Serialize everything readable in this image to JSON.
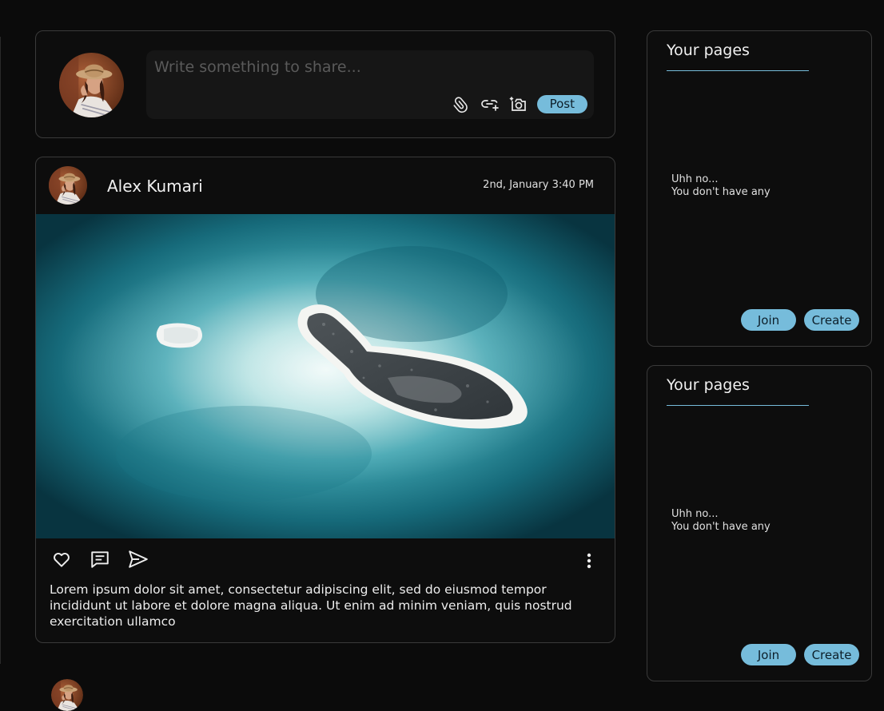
{
  "composer": {
    "placeholder": "Write something to share...",
    "post_label": "Post",
    "icons": [
      "paperclip-icon",
      "link-add-icon",
      "camera-icon"
    ]
  },
  "post": {
    "author": "Alex Kumari",
    "timestamp": "2nd, January 3:40 PM",
    "caption": "Lorem ipsum dolor sit amet, consectetur adipiscing elit, sed do eiusmod tempor incididunt ut labore et dolore magna aliqua. Ut enim ad minim veniam, quis nostrud exercitation ullamco",
    "actions": [
      "heart-icon",
      "comment-icon",
      "send-icon",
      "more-vertical-icon"
    ]
  },
  "panels": [
    {
      "title": "Your pages",
      "empty_line1": "Uhh no...",
      "empty_line2": "You don't have any",
      "join_label": "Join",
      "create_label": "Create"
    },
    {
      "title": "Your pages",
      "empty_line1": "Uhh no...",
      "empty_line2": "You don't have any",
      "join_label": "Join",
      "create_label": "Create"
    }
  ],
  "colors": {
    "accent": "#76bcdb",
    "background": "#0b0b0b",
    "border": "#3a3a3a"
  }
}
